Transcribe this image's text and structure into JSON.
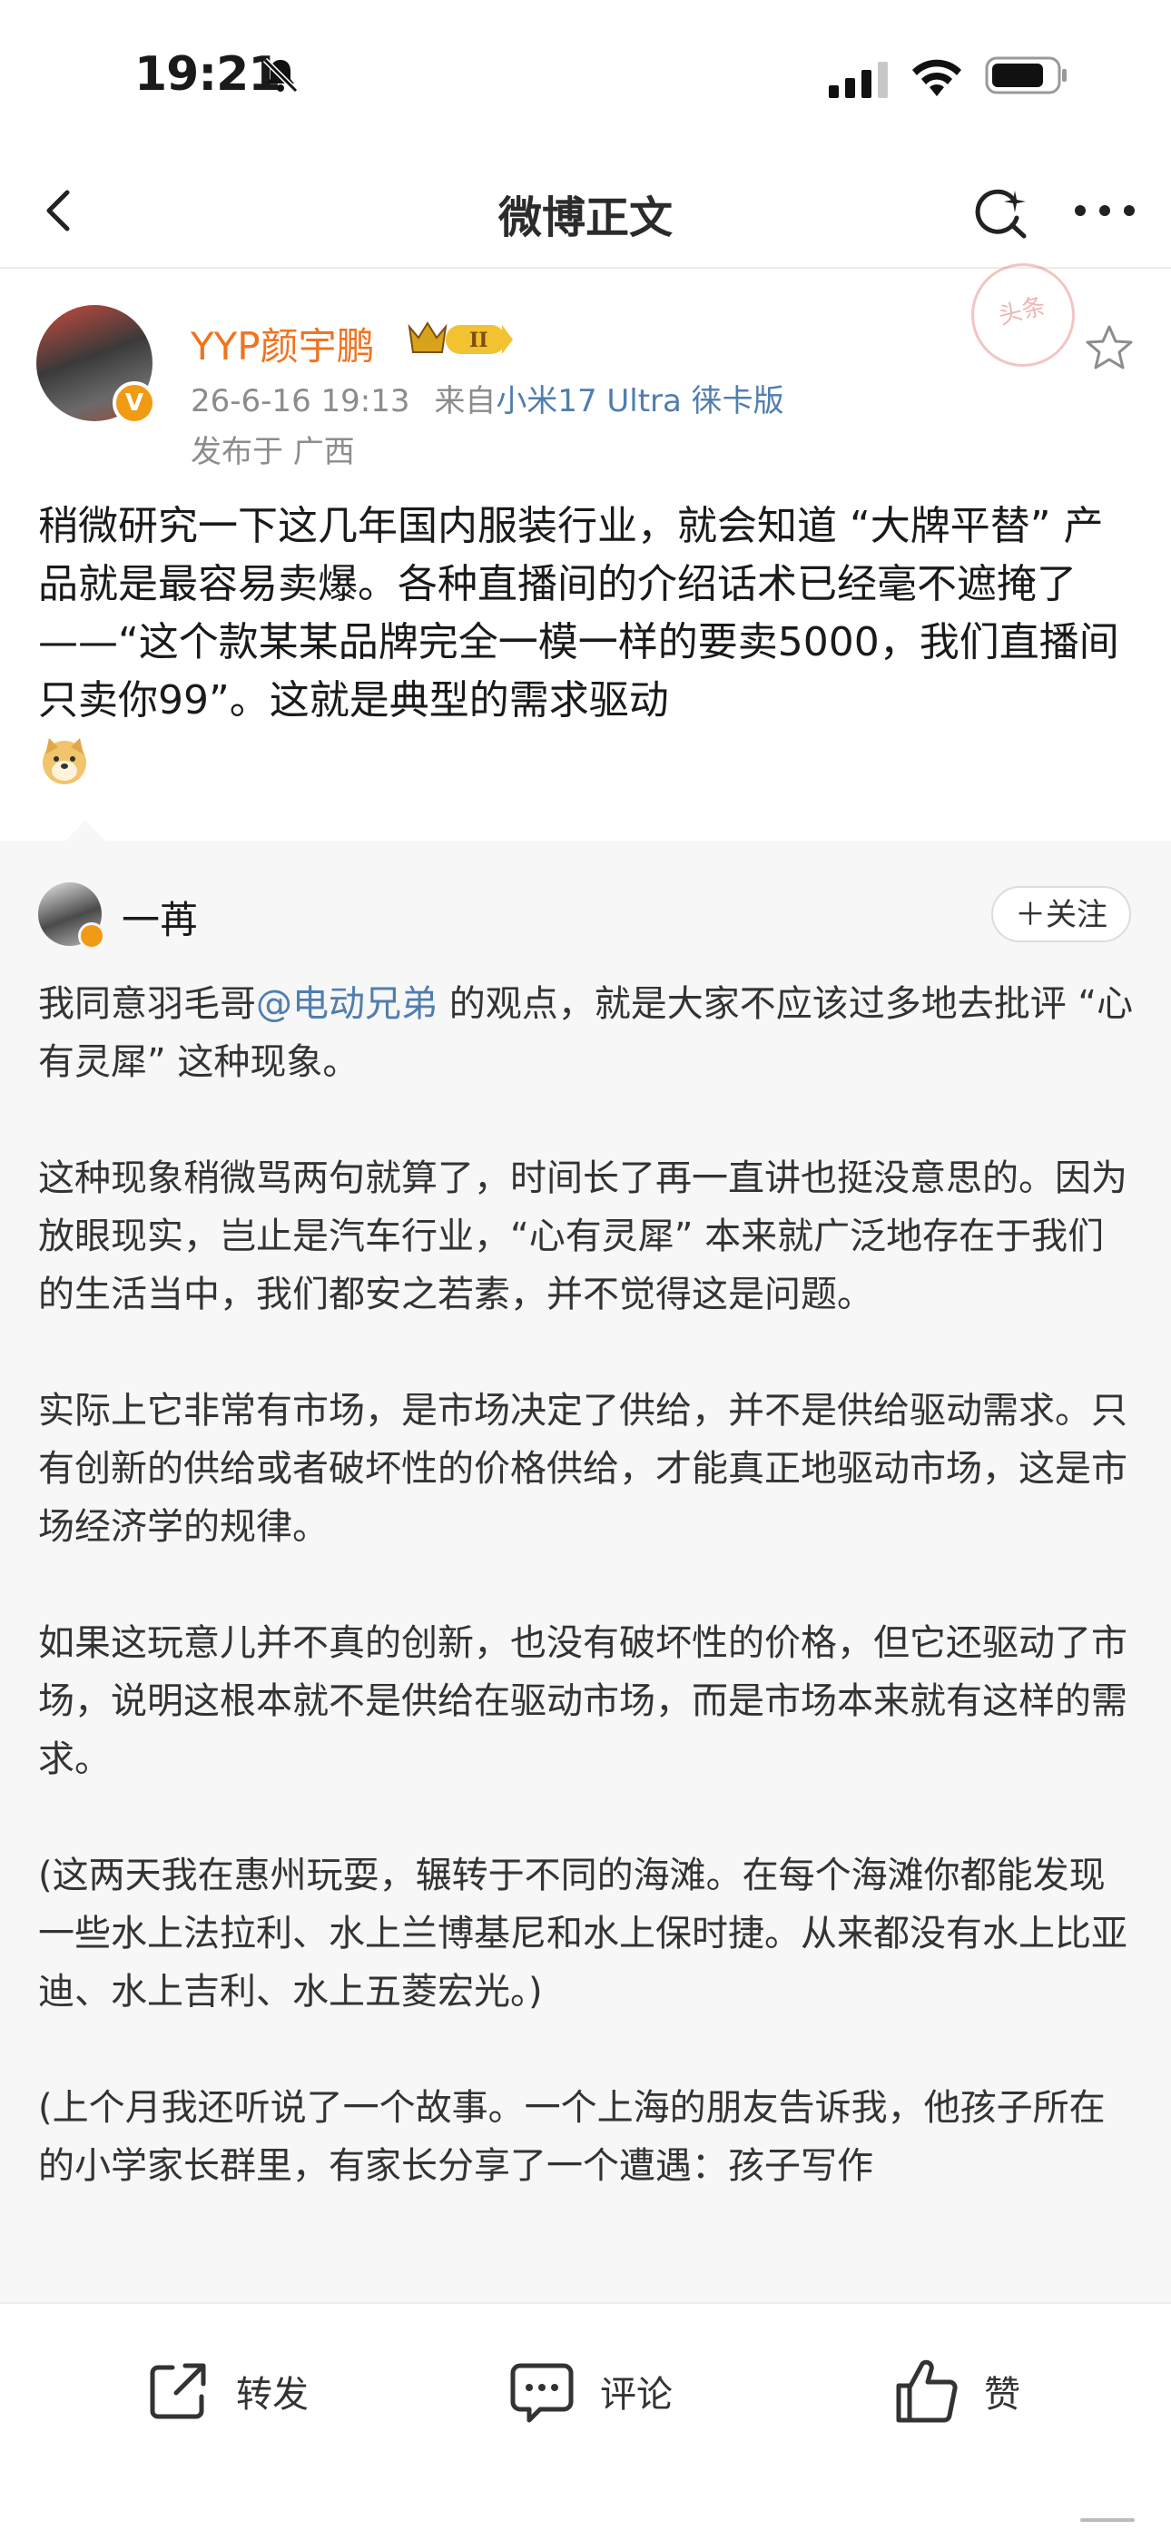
{
  "status_bar": {
    "time": "19:21"
  },
  "nav": {
    "title": "微博正文"
  },
  "post": {
    "author": "YYP颜宇鹏",
    "date": "26-6-16 19:13",
    "source_prefix": "来自",
    "source": "小米17 Ultra 徕卡版",
    "location": "发布于 广西",
    "stamp_text": "头条",
    "text": "稍微研究一下这几年国内服装行业，就会知道 “大牌平替” 产品就是最容易卖爆。各种直播间的介绍话术已经毫不遮掩了——“这个款某某品牌完全一模一样的要卖5000，我们直播间只卖你99”。这就是典型的需求驱动"
  },
  "repost": {
    "author": "一苒",
    "follow_label": "＋关注",
    "p1_before": "我同意羽毛哥",
    "p1_mention": "@电动兄弟",
    "p1_after": " 的观点，就是大家不应该过多地去批评 “心有灵犀” 这种现象。",
    "p2": "这种现象稍微骂两句就算了，时间长了再一直讲也挺没意思的。因为放眼现实，岂止是汽车行业，“心有灵犀” 本来就广泛地存在于我们的生活当中，我们都安之若素，并不觉得这是问题。",
    "p3": "实际上它非常有市场，是市场决定了供给，并不是供给驱动需求。只有创新的供给或者破坏性的价格供给，才能真正地驱动市场，这是市场经济学的规律。",
    "p4": "如果这玩意儿并不真的创新，也没有破坏性的价格，但它还驱动了市场，说明这根本就不是供给在驱动市场，而是市场本来就有这样的需求。",
    "p5": "(这两天我在惠州玩耍，辗转于不同的海滩。在每个海滩你都能发现一些水上法拉利、水上兰博基尼和水上保时捷。从来都没有水上比亚迪、水上吉利、水上五菱宏光。)",
    "p6": "(上个月我还听说了一个故事。一个上海的朋友告诉我，他孩子所在的小学家长群里，有家长分享了一个遭遇：孩子写作"
  },
  "actions": {
    "repost": "转发",
    "comment": "评论",
    "like": "赞"
  },
  "colors": {
    "author_orange": "#f0731f",
    "link_blue": "#507daf",
    "repost_bg": "#f7f7f7"
  }
}
